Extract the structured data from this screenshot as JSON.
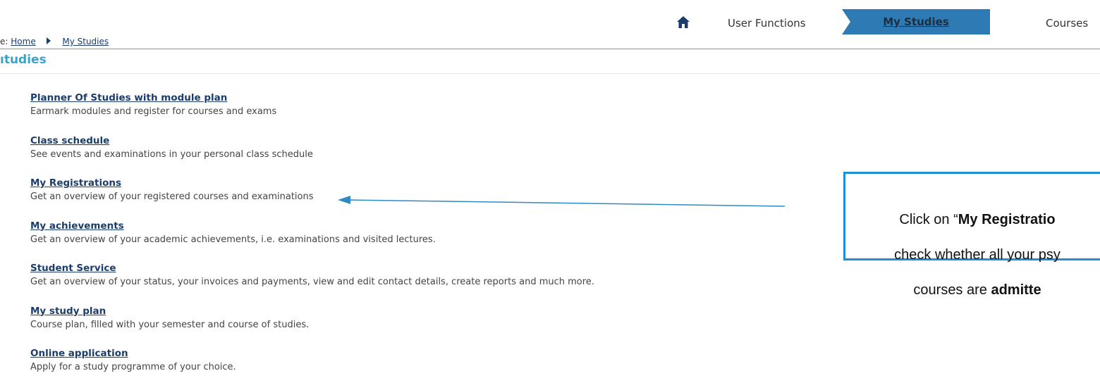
{
  "nav": {
    "home_icon": "home-icon",
    "user_functions": "User Functions",
    "my_studies": "My Studies",
    "courses": "Courses",
    "active_color": "#2e7ab5"
  },
  "breadcrumb": {
    "prefix": "e:",
    "home": "Home",
    "current": "My Studies"
  },
  "page_title": "ıtudies",
  "links": [
    {
      "title": "Planner Of Studies with module plan",
      "desc": "Earmark modules and register for courses and exams"
    },
    {
      "title": "Class schedule",
      "desc": "See events and examinations in your personal class schedule"
    },
    {
      "title": "My Registrations",
      "desc": "Get an overview of your registered courses and examinations"
    },
    {
      "title": "My achievements",
      "desc": "Get an overview of your academic achievements, i.e. examinations and visited lectures."
    },
    {
      "title": "Student Service",
      "desc": "Get an overview of your status, your invoices and payments, view and edit contact details, create reports and much more."
    },
    {
      "title": "My study plan",
      "desc": "Course plan, filled with your semester and course of studies."
    },
    {
      "title": "Online application",
      "desc": "Apply for a study programme of your choice."
    }
  ],
  "callout": {
    "line1_prefix": "Click on “",
    "line1_bold": "My Registratio",
    "line2": "check whether all your psy",
    "line3_prefix": "courses are ",
    "line3_bold": "admitte",
    "border_color": "#1f8fd6"
  }
}
